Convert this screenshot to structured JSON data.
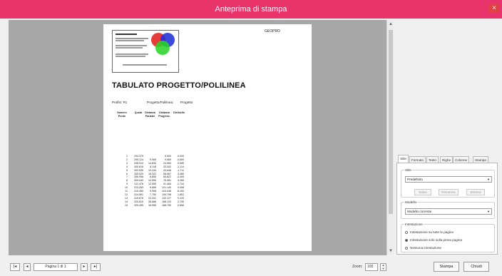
{
  "window": {
    "title": "Anteprima di stampa",
    "close_glyph": "×"
  },
  "document": {
    "company": "GEOPRO",
    "title": "TABULATO PROGETTO/POLILINEA",
    "profile_label": "Profilo: P1",
    "polyline_label": "Progetto/Polilinea:",
    "project_label": "Progetto",
    "table": {
      "headers": [
        "Numero Punto",
        "Quota",
        "Distanza Parziale",
        "Distanza Progress.",
        "Dislivello"
      ],
      "rows": [
        [
          "1",
          "294.379",
          "",
          "0.000",
          "0.000"
        ],
        [
          "2",
          "295.124",
          "9.069",
          "9.069",
          "-0.659"
        ],
        [
          "3",
          "298.910",
          "14.835",
          "24.084",
          "0.585"
        ],
        [
          "4",
          "300.818",
          "8.118",
          "33.402",
          "-1.114"
        ],
        [
          "5",
          "302.535",
          "10.244",
          "43.646",
          "-1.711"
        ],
        [
          "6",
          "305.029",
          "15.322",
          "58.967",
          "3.480"
        ],
        [
          "7",
          "306.956",
          "6.855",
          "65.822",
          "-4.405"
        ],
        [
          "8",
          "309.049",
          "10.559",
          "76.481",
          "4.265"
        ],
        [
          "9",
          "311.476",
          "12.955",
          "91.484",
          "-1.744"
        ],
        [
          "10",
          "313.283",
          "9.855",
          "101.140",
          "0.008"
        ],
        [
          "11",
          "315.450",
          "9.908",
          "103.048",
          "8.154"
        ],
        [
          "12",
          "314.561",
          "7.750",
          "109.798",
          "1.802"
        ],
        [
          "13",
          "319.678",
          "22.331",
          "132.127",
          "0.220"
        ],
        [
          "14",
          "320.819",
          "36.686",
          "168.193",
          "2.795"
        ],
        [
          "15",
          "325.289",
          "16.555",
          "168.750",
          "0.656"
        ]
      ]
    }
  },
  "statusbar": {
    "first_glyph": "|◂",
    "prev_glyph": "◂",
    "page_info": "Pagina 1 di 1",
    "next_glyph": "▸",
    "last_glyph": "▸|",
    "zoom_label": "Zoom:",
    "zoom_value": "100",
    "print_label": "Stampa",
    "close_label": "Chiudi"
  },
  "settings": {
    "tabs": [
      "Stile",
      "Formato",
      "Testo",
      "Righe",
      "Colonne",
      "Stampa"
    ],
    "style_group": "Stile",
    "style_value": "Predefinito",
    "style_buttons": [
      "Salva",
      "Rinomina",
      "Elimina"
    ],
    "model_group": "Modello",
    "model_value": "Modello corrente",
    "header_group": "Intestazione",
    "header_options": [
      {
        "label": "Intestazione su tutte le pagine",
        "selected": false
      },
      {
        "label": "Intestazione solo sulla prima pagina",
        "selected": true
      },
      {
        "label": "Nessuna intestazione",
        "selected": false
      }
    ]
  }
}
